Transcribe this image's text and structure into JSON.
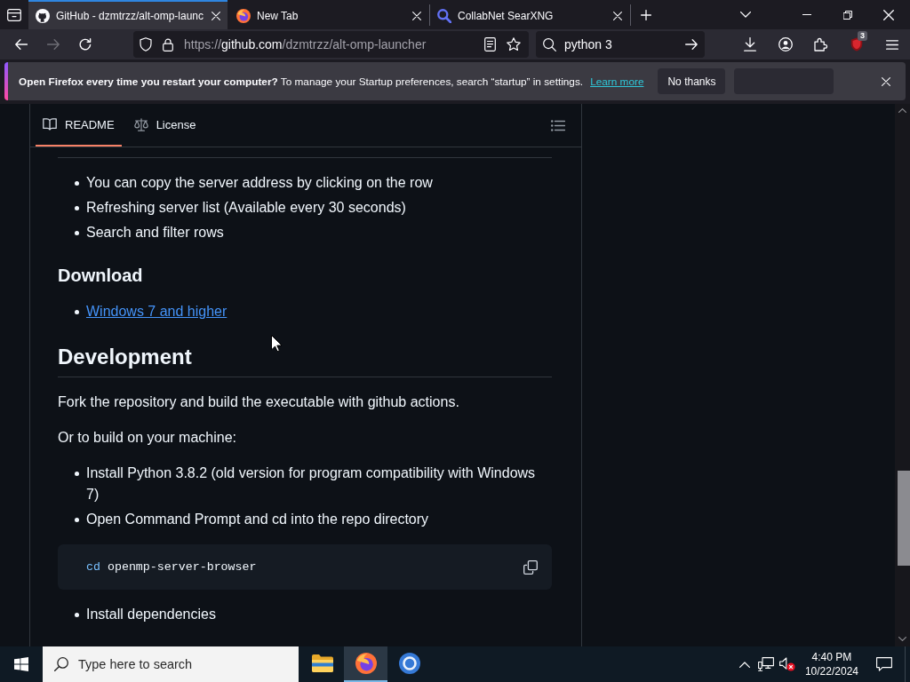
{
  "browser": {
    "tabs": [
      {
        "kind": "repo",
        "title": "GitHub - dzmtrzz/alt-omp-launc",
        "selected": true
      },
      {
        "kind": "newtab",
        "title": "New Tab",
        "selected": false
      },
      {
        "kind": "search",
        "title": "CollabNet SearXNG",
        "selected": false
      }
    ],
    "toolbar": {
      "nav": [
        {
          "kind": "back",
          "disabled": false
        },
        {
          "kind": "forward",
          "disabled": true
        },
        {
          "kind": "reload",
          "disabled": false
        }
      ],
      "url": "https://github.com/dzmtrzz/alt-omp-launcher",
      "search": {
        "value": "python 3"
      },
      "extension_badge": "3"
    },
    "notification": {
      "message": "**Open Firefox every time you restart your computer?** To manage your Startup preferences, search “startup” in settings.",
      "link": "Learn more",
      "buttons": [
        {
          "kind": "text",
          "label": "No thanks"
        },
        {
          "kind": "blank"
        }
      ]
    }
  },
  "readme": {
    "tabs": [
      {
        "kind": "readme",
        "label": "README",
        "selected": true
      },
      {
        "kind": "license",
        "label": "License",
        "selected": false
      }
    ],
    "blocks": [
      {
        "kind": "list",
        "items": [
          {
            "text": "You can copy the server address by clicking on the row",
            "link": false
          },
          {
            "text": "Refreshing server list (Available every 30 seconds)",
            "link": false
          },
          {
            "text": "Search and filter rows",
            "link": false
          }
        ]
      },
      {
        "kind": "h3",
        "text": "Download"
      },
      {
        "kind": "list",
        "items": [
          {
            "text": "Windows 7 and higher",
            "link": true
          }
        ]
      },
      {
        "kind": "h2",
        "text": "Development"
      },
      {
        "kind": "paragraph",
        "text": "Fork the repository and build the executable with github actions."
      },
      {
        "kind": "paragraph",
        "text": "Or to build on your machine:"
      },
      {
        "kind": "list",
        "items": [
          {
            "text": "Install Python 3.8.2 (old version for program compatibility with Windows 7)",
            "link": false
          },
          {
            "text": "Open Command Prompt and cd into the repo directory",
            "link": false
          }
        ]
      },
      {
        "kind": "code",
        "tokens": [
          {
            "kind": "builtin",
            "text": "cd"
          },
          {
            "kind": "plain",
            "text": "openmp-server-browser"
          }
        ]
      },
      {
        "kind": "list",
        "items": [
          {
            "text": "Install dependencies",
            "link": false
          }
        ]
      }
    ]
  },
  "taskbar": {
    "search": {
      "placeholder": "Type here to search"
    },
    "apps": [
      {
        "kind": "files",
        "active": false
      },
      {
        "kind": "firefox",
        "active": true
      },
      {
        "kind": "ring",
        "active": false
      }
    ],
    "tray": {
      "volume_muted": true
    },
    "clock": {
      "time": "4:40 PM",
      "date": "10/22/2024"
    }
  }
}
